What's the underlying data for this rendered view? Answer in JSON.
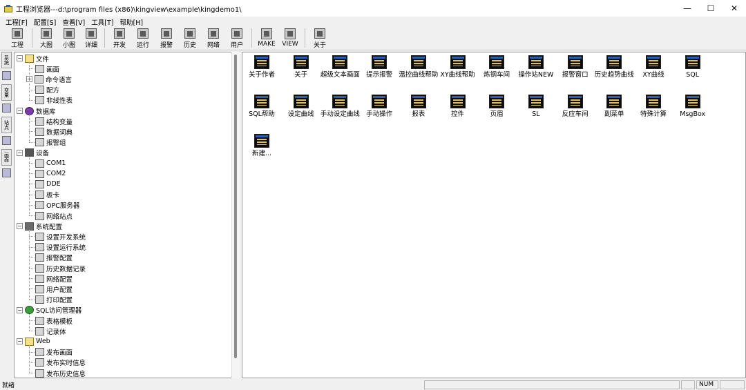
{
  "window": {
    "title": "工程浏览器---d:\\program files (x86)\\kingview\\example\\kingdemo1\\",
    "minimize_glyph": "—",
    "maximize_glyph": "☐",
    "close_glyph": "✕"
  },
  "menu": [
    "工程[F]",
    "配置[S]",
    "查看[V]",
    "工具[T]",
    "帮助[H]"
  ],
  "toolbar": [
    {
      "label": "工程",
      "icon": "project-icon"
    },
    {
      "label": "大图",
      "icon": "large-icons-icon"
    },
    {
      "label": "小图",
      "icon": "small-icons-icon"
    },
    {
      "label": "详细",
      "icon": "details-icon"
    },
    {
      "label": "开发",
      "icon": "develop-icon"
    },
    {
      "label": "运行",
      "icon": "run-icon"
    },
    {
      "label": "报警",
      "icon": "alarm-icon"
    },
    {
      "label": "历史",
      "icon": "history-icon"
    },
    {
      "label": "网络",
      "icon": "network-icon"
    },
    {
      "label": "用户",
      "icon": "user-icon"
    },
    {
      "label": "MAKE",
      "icon": "make-icon"
    },
    {
      "label": "VIEW",
      "icon": "view-icon"
    },
    {
      "label": "关于",
      "icon": "about-icon"
    }
  ],
  "vtabs": [
    "系统",
    "变量",
    "站点",
    "画面"
  ],
  "tree": [
    {
      "label": "文件",
      "level": 0,
      "expanded": true,
      "icon": "folder-icon"
    },
    {
      "label": "画面",
      "level": 1,
      "icon": "screen-icon"
    },
    {
      "label": "命令语言",
      "level": 1,
      "icon": "command-icon",
      "collapsed": true
    },
    {
      "label": "配方",
      "level": 1,
      "icon": "recipe-icon"
    },
    {
      "label": "非线性表",
      "level": 1,
      "icon": "table-icon"
    },
    {
      "label": "数据库",
      "level": 0,
      "expanded": true,
      "icon": "database-icon"
    },
    {
      "label": "结构变量",
      "level": 1,
      "icon": "struct-icon"
    },
    {
      "label": "数据词典",
      "level": 1,
      "icon": "dictionary-icon"
    },
    {
      "label": "报警组",
      "level": 1,
      "icon": "alarm-group-icon"
    },
    {
      "label": "设备",
      "level": 0,
      "expanded": true,
      "icon": "device-icon"
    },
    {
      "label": "COM1",
      "level": 1,
      "icon": "com-icon"
    },
    {
      "label": "COM2",
      "level": 1,
      "icon": "com-icon"
    },
    {
      "label": "DDE",
      "level": 1,
      "icon": "dde-icon"
    },
    {
      "label": "板卡",
      "level": 1,
      "icon": "board-icon"
    },
    {
      "label": "OPC服务器",
      "level": 1,
      "icon": "opc-icon"
    },
    {
      "label": "网络站点",
      "level": 1,
      "icon": "network-site-icon"
    },
    {
      "label": "系统配置",
      "level": 0,
      "expanded": true,
      "icon": "tools-icon"
    },
    {
      "label": "设置开发系统",
      "level": 1,
      "icon": "dev-settings-icon"
    },
    {
      "label": "设置运行系统",
      "level": 1,
      "icon": "run-settings-icon"
    },
    {
      "label": "报警配置",
      "level": 1,
      "icon": "alarm-config-icon"
    },
    {
      "label": "历史数据记录",
      "level": 1,
      "icon": "history-record-icon"
    },
    {
      "label": "网络配置",
      "level": 1,
      "icon": "network-config-icon"
    },
    {
      "label": "用户配置",
      "level": 1,
      "icon": "user-config-icon"
    },
    {
      "label": "打印配置",
      "level": 1,
      "icon": "print-config-icon"
    },
    {
      "label": "SQL访问管理器",
      "level": 0,
      "expanded": true,
      "icon": "sql-icon"
    },
    {
      "label": "表格模板",
      "level": 1,
      "icon": "template-icon"
    },
    {
      "label": "记录体",
      "level": 1,
      "icon": "record-icon"
    },
    {
      "label": "Web",
      "level": 0,
      "expanded": true,
      "icon": "folder-icon"
    },
    {
      "label": "发布画面",
      "level": 1,
      "icon": "publish-icon"
    },
    {
      "label": "发布实时信息",
      "level": 1,
      "icon": "publish-realtime-icon"
    },
    {
      "label": "发布历史信息",
      "level": 1,
      "icon": "publish-history-icon"
    }
  ],
  "screens": [
    {
      "label": "关于作者"
    },
    {
      "label": "关于"
    },
    {
      "label": "超级文本画面"
    },
    {
      "label": "提示报警"
    },
    {
      "label": "温控曲线帮助"
    },
    {
      "label": "XY曲线帮助"
    },
    {
      "label": "炼钢车间"
    },
    {
      "label": "操作站NEW"
    },
    {
      "label": "报警窗口"
    },
    {
      "label": "历史趋势曲线"
    },
    {
      "label": "XY曲线"
    },
    {
      "label": "SQL"
    },
    {
      "label": "SQL帮助"
    },
    {
      "label": "设定曲线"
    },
    {
      "label": "手动设定曲线"
    },
    {
      "label": "手动操作"
    },
    {
      "label": "报表"
    },
    {
      "label": "控件"
    },
    {
      "label": "页眉"
    },
    {
      "label": "SL"
    },
    {
      "label": "反应车间"
    },
    {
      "label": "副菜单"
    },
    {
      "label": "特殊计算"
    },
    {
      "label": "MsgBox"
    },
    {
      "label": "新建..."
    }
  ],
  "status": {
    "text": "就绪",
    "num": "NUM"
  }
}
